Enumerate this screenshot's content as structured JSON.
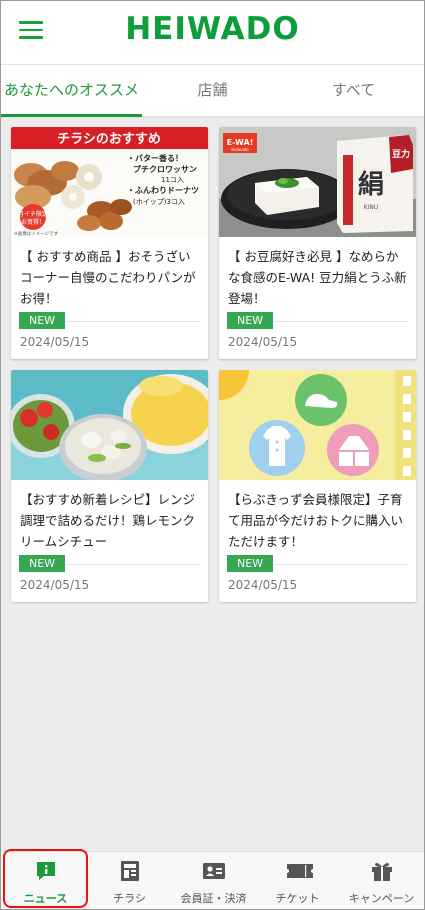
{
  "header": {
    "logo": "HEIWADO"
  },
  "tabs": [
    {
      "label": "あなたへのオススメ",
      "active": true
    },
    {
      "label": "店舗",
      "active": false
    },
    {
      "label": "すべて",
      "active": false
    }
  ],
  "cards": [
    {
      "title": "【 おすすめ商品 】おそうざいコーナー自慢のこだわりパンがお得！",
      "badge": "NEW",
      "date": "2024/05/15",
      "image": {
        "banner": "チラシのおすすめ",
        "line1": "・バター香る！",
        "line2": "プチクロワッサン",
        "line3": "11コ入",
        "line4": "・ふんわりドーナツ",
        "line5": "(ホイップ)3コ入",
        "sticker1": "月イチ限定",
        "sticker2": "お買得！",
        "note": "※画像はイメージです"
      }
    },
    {
      "title": "【 お豆腐好き必見 】なめらかな食感のE-WA! 豆力絹とうふ新登場！",
      "badge": "NEW",
      "date": "2024/05/15",
      "image": {
        "brand": "E-WA!",
        "brand_sub": "Heiwado",
        "pack_big": "絹",
        "pack_side": "豆力",
        "pack_roman": "KINU"
      }
    },
    {
      "title": "【おすすめ新着レシピ】レンジ調理で詰めるだけ！鶏レモンクリームシチュー",
      "badge": "NEW",
      "date": "2024/05/15",
      "image": {}
    },
    {
      "title": "【らぶきっず会員様限定】子育て用品が今だけおトクに購入いただけます！",
      "badge": "NEW",
      "date": "2024/05/15",
      "image": {}
    }
  ],
  "bottom_nav": [
    {
      "label": "ニュース",
      "icon": "news-icon",
      "active": true
    },
    {
      "label": "チラシ",
      "icon": "flyer-icon",
      "active": false
    },
    {
      "label": "会員証・決済",
      "icon": "member-card-icon",
      "active": false
    },
    {
      "label": "チケット",
      "icon": "ticket-icon",
      "active": false
    },
    {
      "label": "キャンペーン",
      "icon": "gift-icon",
      "active": false
    }
  ],
  "colors": {
    "brand_green": "#0d9d3a",
    "badge_green": "#36a853",
    "highlight_red": "#e11111"
  }
}
